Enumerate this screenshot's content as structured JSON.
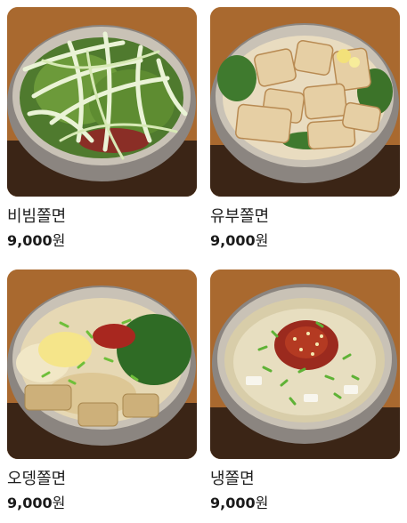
{
  "menu": [
    {
      "name": "비빔쫄면",
      "price": "9,000",
      "currency": "원",
      "photo_icon": "bibim-jjolmyeon-photo"
    },
    {
      "name": "유부쫄면",
      "price": "9,000",
      "currency": "원",
      "photo_icon": "yubu-jjolmyeon-photo"
    },
    {
      "name": "오뎅쫄면",
      "price": "9,000",
      "currency": "원",
      "photo_icon": "odeng-jjolmyeon-photo"
    },
    {
      "name": "냉쫄면",
      "price": "9,000",
      "currency": "원",
      "photo_icon": "naeng-jjolmyeon-photo"
    }
  ]
}
